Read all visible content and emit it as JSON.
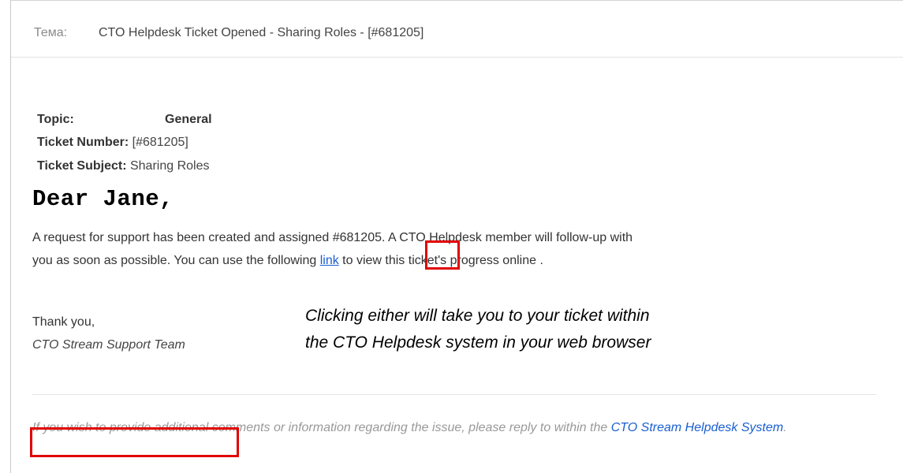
{
  "subject": {
    "label": "Тема:",
    "text": "CTO Helpdesk Ticket Opened - Sharing Roles - [#681205]"
  },
  "ticket": {
    "topic_label": "Topic:",
    "topic_value": "General",
    "number_label": "Ticket Number:",
    "number_value": "[#681205]",
    "subject_label": "Ticket Subject:",
    "subject_value": "Sharing Roles"
  },
  "greeting": "Dear Jane,",
  "body": {
    "line1": "A request for support has been created and assigned #681205. A CTO Helpdesk member will follow-up with",
    "line2_before": "you as soon as possible. You can use the following ",
    "link_text": "link",
    "line2_after": " to view this ticket's progress online ."
  },
  "signature": {
    "thanks": "Thank you,",
    "team": "CTO Stream Support Team"
  },
  "callout": {
    "line1": "Clicking either will take you to your ticket within",
    "line2": "the CTO Helpdesk system in your web browser"
  },
  "footer": {
    "struck_text": "If you wish to provide additi",
    "text": "onal comments or information regarding the issue, please reply to within the ",
    "link_text": "CTO Stream Helpdesk System",
    "end": "."
  },
  "colors": {
    "link": "#1a5fd0",
    "highlight": "#e10000"
  }
}
